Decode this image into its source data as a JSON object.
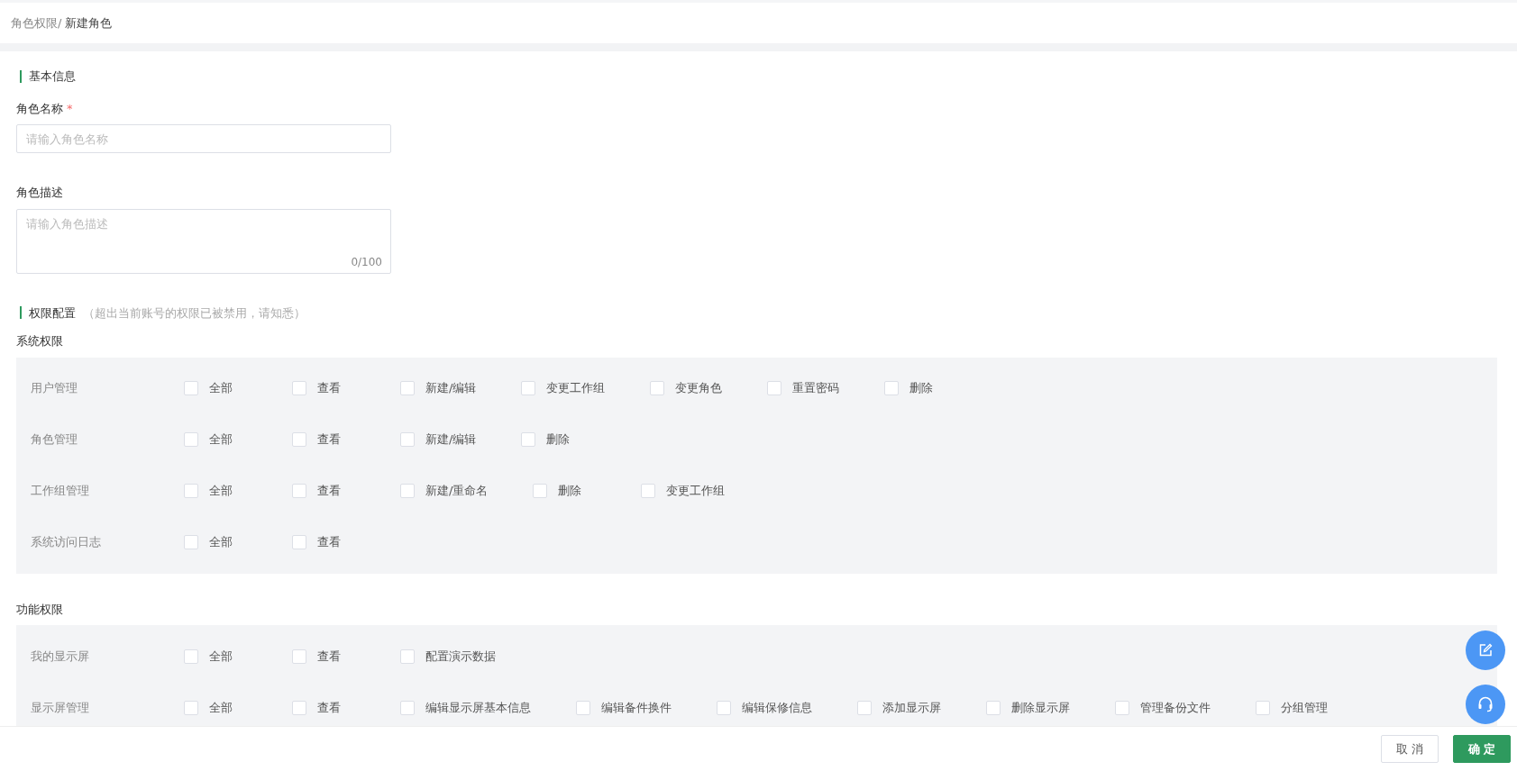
{
  "breadcrumb": [
    {
      "label": "角色权限/",
      "current": false
    },
    {
      "label": "新建角色",
      "current": true
    }
  ],
  "basic_section": {
    "title": "基本信息"
  },
  "fields": [
    {
      "kind": "input",
      "label": "角色名称",
      "required_mark": "*",
      "placeholder": "请输入角色名称"
    },
    {
      "kind": "textarea",
      "label": "角色描述",
      "placeholder": "请输入角色描述",
      "counter": "0/100"
    }
  ],
  "permission_section": {
    "title": "权限配置",
    "note": "（超出当前账号的权限已被禁用，请知悉）"
  },
  "permission_groups": [
    {
      "title": "系统权限",
      "rows": [
        {
          "label": "用户管理",
          "options": [
            {
              "label": "全部",
              "checked": false
            },
            {
              "label": "查看",
              "checked": false
            },
            {
              "label": "新建/编辑",
              "checked": false
            },
            {
              "label": "变更工作组",
              "checked": false
            },
            {
              "label": "变更角色",
              "checked": false
            },
            {
              "label": "重置密码",
              "checked": false
            },
            {
              "label": "删除",
              "checked": false
            }
          ]
        },
        {
          "label": "角色管理",
          "options": [
            {
              "label": "全部",
              "checked": false
            },
            {
              "label": "查看",
              "checked": false
            },
            {
              "label": "新建/编辑",
              "checked": false
            },
            {
              "label": "删除",
              "checked": false
            }
          ]
        },
        {
          "label": "工作组管理",
          "options": [
            {
              "label": "全部",
              "checked": false
            },
            {
              "label": "查看",
              "checked": false
            },
            {
              "label": "新建/重命名",
              "checked": false
            },
            {
              "label": "删除",
              "checked": false
            },
            {
              "label": "变更工作组",
              "checked": false
            }
          ]
        },
        {
          "label": "系统访问日志",
          "options": [
            {
              "label": "全部",
              "checked": false
            },
            {
              "label": "查看",
              "checked": false
            }
          ]
        }
      ]
    },
    {
      "title": "功能权限",
      "rows": [
        {
          "label": "我的显示屏",
          "options": [
            {
              "label": "全部",
              "checked": false
            },
            {
              "label": "查看",
              "checked": false
            },
            {
              "label": "配置演示数据",
              "checked": false
            }
          ]
        },
        {
          "label": "显示屏管理",
          "options": [
            {
              "label": "全部",
              "checked": false
            },
            {
              "label": "查看",
              "checked": false
            },
            {
              "label": "编辑显示屏基本信息",
              "checked": false
            },
            {
              "label": "编辑备件换件",
              "checked": false
            },
            {
              "label": "编辑保修信息",
              "checked": false
            },
            {
              "label": "添加显示屏",
              "checked": false
            },
            {
              "label": "删除显示屏",
              "checked": false
            },
            {
              "label": "管理备份文件",
              "checked": false
            },
            {
              "label": "分组管理",
              "checked": false
            }
          ]
        }
      ]
    }
  ],
  "footer_buttons": [
    {
      "kind": "secondary",
      "label": "取 消"
    },
    {
      "kind": "primary",
      "label": "确 定"
    }
  ]
}
